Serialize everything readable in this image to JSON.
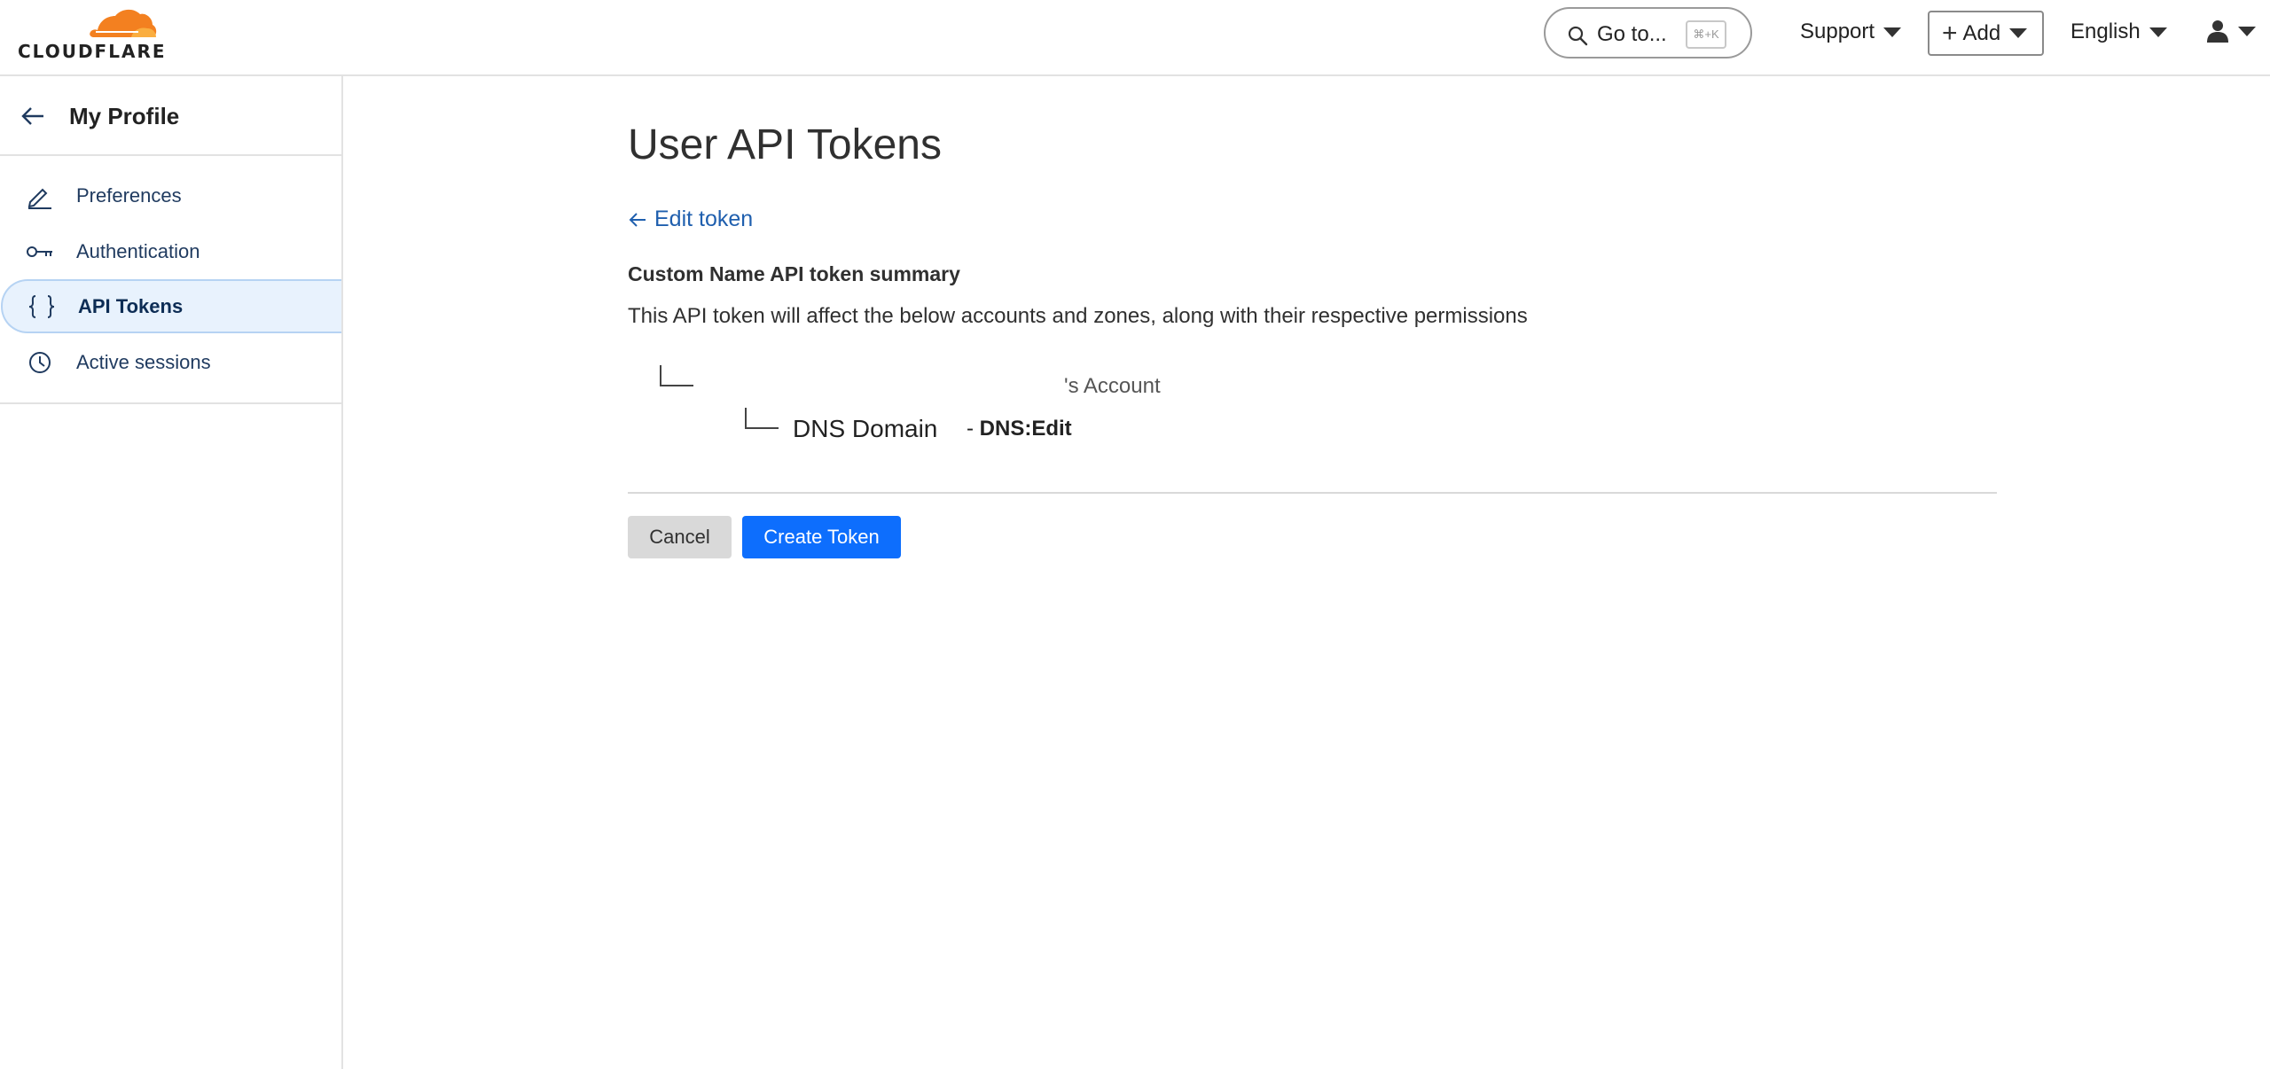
{
  "header": {
    "logo_text": "CLOUDFLARE",
    "goto_label": "Go to...",
    "goto_shortcut": "⌘+K",
    "support_label": "Support",
    "add_label": "Add",
    "language_label": "English"
  },
  "sidebar": {
    "title": "My Profile",
    "items": [
      {
        "label": "Preferences",
        "icon": "pencil-icon"
      },
      {
        "label": "Authentication",
        "icon": "key-icon"
      },
      {
        "label": "API Tokens",
        "icon": "braces-icon",
        "active": true
      },
      {
        "label": "Active sessions",
        "icon": "clock-icon"
      }
    ]
  },
  "main": {
    "title": "User API Tokens",
    "edit_link": "Edit token",
    "summary_title": "Custom Name API token summary",
    "summary_desc": "This API token will affect the below accounts and zones, along with their respective permissions",
    "account_text": "'s Account",
    "zone_name": "DNS Domain",
    "permission_prefix": "-",
    "permission": "DNS:Edit",
    "cancel_label": "Cancel",
    "create_label": "Create Token"
  },
  "colors": {
    "accent": "#0d6efd",
    "link": "#1f5fae",
    "logo_orange": "#f38020",
    "logo_light_orange": "#faae40",
    "active_bg": "#e8f2fd"
  }
}
